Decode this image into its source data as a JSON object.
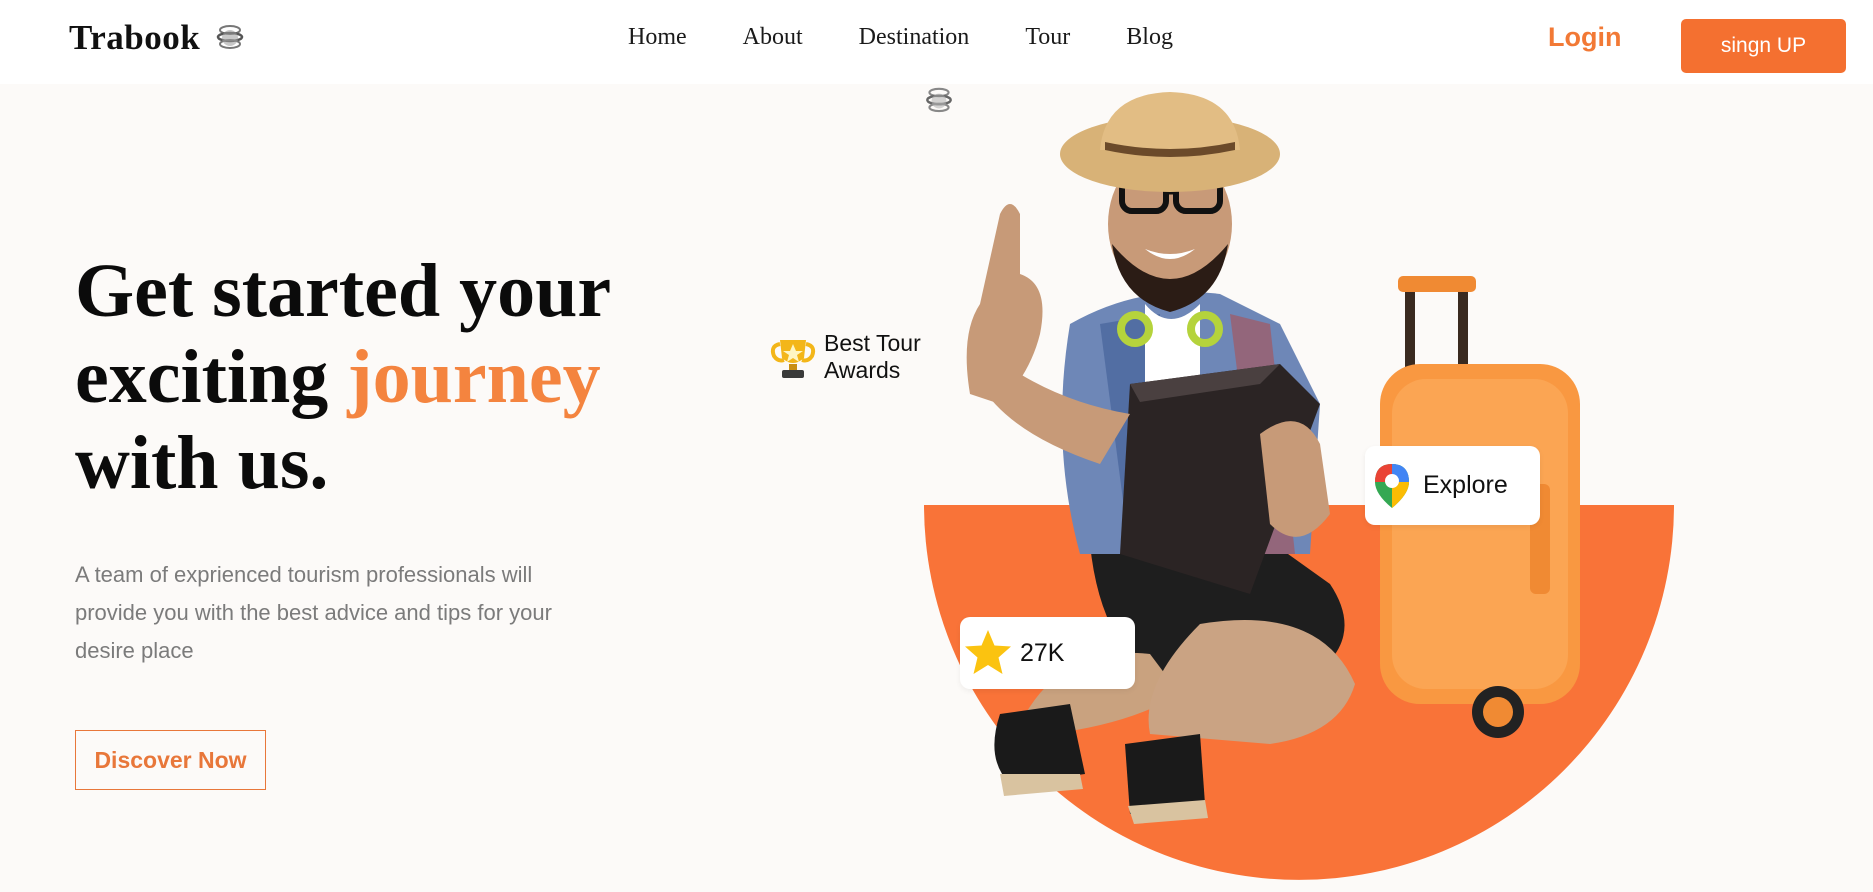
{
  "brand": {
    "name": "Trabook",
    "icon": "globe-icon"
  },
  "nav": {
    "items": [
      "Home",
      "About",
      "Destination",
      "Tour",
      "Blog"
    ]
  },
  "auth": {
    "login_label": "Login",
    "signup_label": "singn UP"
  },
  "hero": {
    "title_line1": "Get started your",
    "title_line2_prefix": "exciting ",
    "title_highlight": "journey",
    "title_line3": "with us.",
    "description": "A team of exprienced tourism professionals will provide you with the best advice and tips for your desire place",
    "cta_label": "Discover Now"
  },
  "badges": {
    "awards": {
      "line1": "Best Tour",
      "line2": "Awards",
      "icon": "trophy-icon"
    },
    "explore": {
      "label": "Explore",
      "icon": "map-pin-icon"
    },
    "rating": {
      "value": "27K",
      "icon": "star-icon"
    }
  },
  "colors": {
    "accent": "#f47030",
    "highlight": "#f4843f",
    "background": "#fcfaf8",
    "text": "#0b0b0b",
    "muted": "#7b7b7b"
  }
}
